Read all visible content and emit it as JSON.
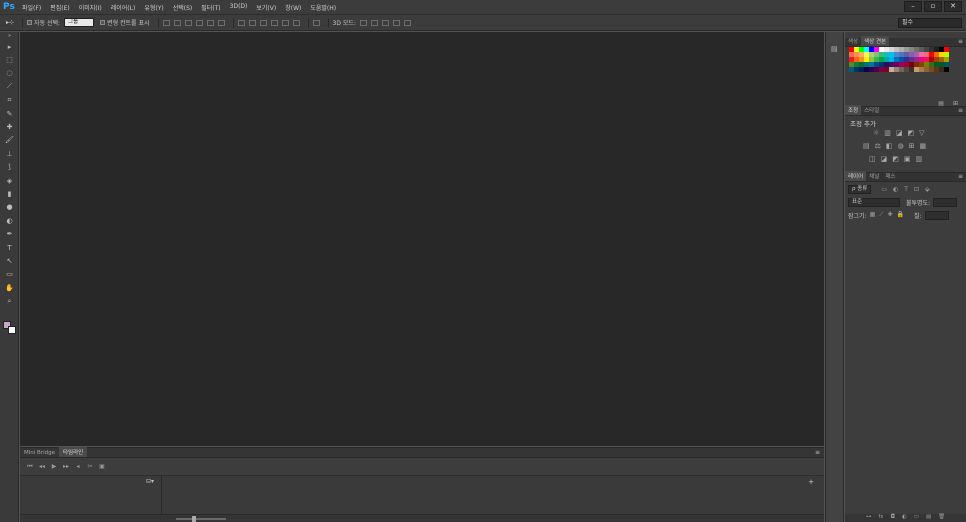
{
  "app": {
    "logo": "Ps"
  },
  "menu": [
    "파일(F)",
    "편집(E)",
    "이미지(I)",
    "레이어(L)",
    "유형(Y)",
    "선택(S)",
    "필터(T)",
    "3D(D)",
    "보기(V)",
    "창(W)",
    "도움말(H)"
  ],
  "window_controls": {
    "minimize": "–",
    "restore": "▫",
    "close": "✕"
  },
  "options_bar": {
    "tool_glyph": "▸⊹",
    "auto_select_label": "자동 선택:",
    "auto_select_value": "그룹",
    "show_transform_label": "변형 컨트롤 표시",
    "mode_3d_label": "3D 모드:",
    "workspace": "필수"
  },
  "tools": [
    "▸",
    "⬚",
    "◌",
    "⟋",
    "⌗",
    "✎",
    "✚",
    "🖌",
    "⊥",
    "⟆",
    "◈",
    "▮",
    "●",
    "◐",
    "✒",
    "T",
    "↖",
    "▭",
    "✋",
    "⌕"
  ],
  "colors": {
    "foreground": "#c8a4c8",
    "background": "#ffffff",
    "canvas": "#282828",
    "accent": "#31a8ff"
  },
  "timeline": {
    "tabs": [
      "Mini Bridge",
      "타임라인"
    ],
    "active_tab": 1,
    "controls": [
      "⏮",
      "◂◂",
      "▶",
      "▸▸",
      "◂",
      "✂",
      "▣"
    ],
    "create_button": "⊟▾",
    "add_track": "+"
  },
  "swatches": {
    "tabs": [
      "색상",
      "색상 견본"
    ],
    "active_tab": 1,
    "colors": [
      "#ff0000",
      "#ffff00",
      "#00ff00",
      "#00ffff",
      "#0000ff",
      "#ff00ff",
      "#ffffff",
      "#ebebeb",
      "#d6d6d6",
      "#c2c2c2",
      "#adadad",
      "#999999",
      "#858585",
      "#707070",
      "#5c5c5c",
      "#474747",
      "#333333",
      "#1f1f1f",
      "#000000",
      "#ff0000",
      "#f26c4f",
      "#f68e55",
      "#fbaf5c",
      "#fff467",
      "#acd372",
      "#7cc576",
      "#3bb878",
      "#1abbb4",
      "#00bff3",
      "#438cca",
      "#5574b9",
      "#605ca8",
      "#855fa8",
      "#a763a8",
      "#f06ea9",
      "#f26d7d",
      "#ff0000",
      "#ff6a00",
      "#ffd800",
      "#b6ff00",
      "#ed1c24",
      "#f26522",
      "#f7941d",
      "#fff200",
      "#8dc73f",
      "#39b54a",
      "#00a651",
      "#00a99d",
      "#00aeef",
      "#0072bc",
      "#0054a6",
      "#2e3192",
      "#662d91",
      "#92278f",
      "#ec008c",
      "#ed145b",
      "#9e0b0f",
      "#a0410d",
      "#a36209",
      "#aba000",
      "#598527",
      "#1a7b30",
      "#007236",
      "#00746b",
      "#0076a3",
      "#004b80",
      "#003471",
      "#1b1464",
      "#440e62",
      "#630460",
      "#9e005d",
      "#9e0039",
      "#790000",
      "#7b2e00",
      "#7d4900",
      "#827b00",
      "#406618",
      "#005e20",
      "#005826",
      "#005952",
      "#005b7f",
      "#003663",
      "#002157",
      "#0d004c",
      "#32004b",
      "#4b0049",
      "#7b0046",
      "#7a0026",
      "#c7b299",
      "#998675",
      "#736357",
      "#534741",
      "#37302d",
      "#c69c6d",
      "#a67c52",
      "#8c6239",
      "#754c24",
      "#603913",
      "#3c2a1a",
      "#000000"
    ],
    "footer": [
      "▤",
      "⊞"
    ]
  },
  "adjustments": {
    "tabs": [
      "조정",
      "스타일"
    ],
    "active_tab": 0,
    "title": "조정 추가",
    "row1": [
      "☼",
      "▥",
      "◪",
      "◩",
      "▽"
    ],
    "row2": [
      "▤",
      "⚖",
      "◧",
      "◍",
      "⊞",
      "▦"
    ],
    "row3": [
      "◫",
      "◪",
      "◩",
      "▣",
      "▥"
    ]
  },
  "layers": {
    "tabs": [
      "레이어",
      "채널",
      "패스"
    ],
    "active_tab": 0,
    "filter_kind": "ρ 종류",
    "blend_mode": "표준",
    "opacity_label": "불투명도:",
    "lock_label": "잠그기:",
    "fill_label": "칠:",
    "filter_icons": [
      "▭",
      "◐",
      "T",
      "⊡",
      "⬙"
    ],
    "lock_icons": [
      "▦",
      "⟋",
      "✚",
      "🔒"
    ],
    "footer_icons": [
      "⊶",
      "fx",
      "◘",
      "◐",
      "▭",
      "▤",
      "🗑"
    ]
  }
}
